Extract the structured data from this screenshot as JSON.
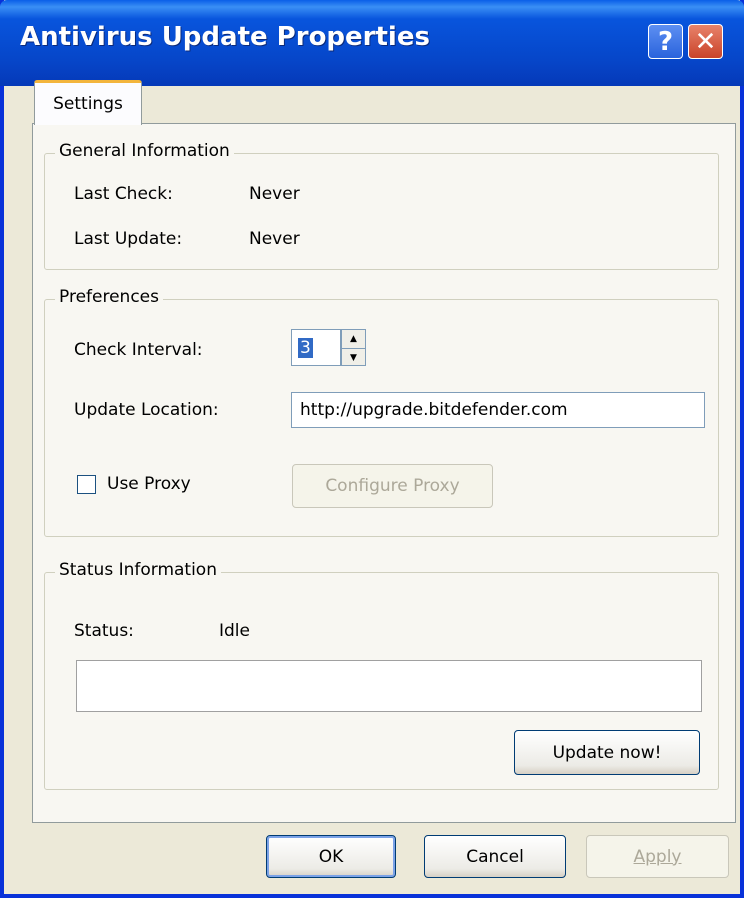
{
  "window": {
    "title": "Antivirus Update Properties",
    "help_label": "?",
    "close_label": "✕"
  },
  "tabs": [
    {
      "label": "Settings",
      "active": true
    }
  ],
  "general": {
    "legend": "General Information",
    "last_check_label": "Last Check:",
    "last_check_value": "Never",
    "last_update_label": "Last Update:",
    "last_update_value": "Never"
  },
  "preferences": {
    "legend": "Preferences",
    "check_interval_label": "Check Interval:",
    "check_interval_value": "3",
    "update_location_label": "Update Location:",
    "update_location_value": "http://upgrade.bitdefender.com",
    "use_proxy_label": "Use Proxy",
    "use_proxy_checked": false,
    "configure_proxy_label": "Configure Proxy"
  },
  "status": {
    "legend": "Status Information",
    "status_label": "Status:",
    "status_value": "Idle",
    "progress_fraction": 0,
    "update_now_label": "Update now!"
  },
  "footer": {
    "ok_label": "OK",
    "cancel_label": "Cancel",
    "apply_label": "Apply"
  },
  "colors": {
    "titlebar": "#0646c9",
    "dialog_bg": "#ece9d8",
    "tab_accent": "#f3b53c",
    "selection": "#316ac5"
  }
}
